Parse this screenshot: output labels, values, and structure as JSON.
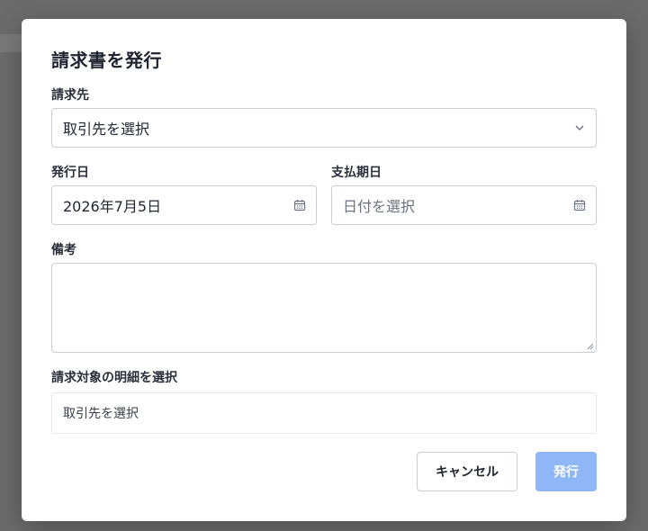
{
  "dialog": {
    "title": "請求書を発行",
    "billing_to": {
      "label": "請求先",
      "placeholder": "取引先を選択"
    },
    "issue_date": {
      "label": "発行日",
      "value": "2026年7月5日"
    },
    "due_date": {
      "label": "支払期日",
      "placeholder": "日付を選択"
    },
    "notes": {
      "label": "備考",
      "value": ""
    },
    "line_items": {
      "label": "請求対象の明細を選択",
      "empty_text": "取引先を選択"
    },
    "cancel_label": "キャンセル",
    "submit_label": "発行"
  },
  "icons": {
    "select_arrow": "chevron-down-icon",
    "date_picker": "calendar-icon"
  },
  "colors": {
    "primary_disabled": "#8fb6f6",
    "overlay": "#6b6b6b"
  }
}
